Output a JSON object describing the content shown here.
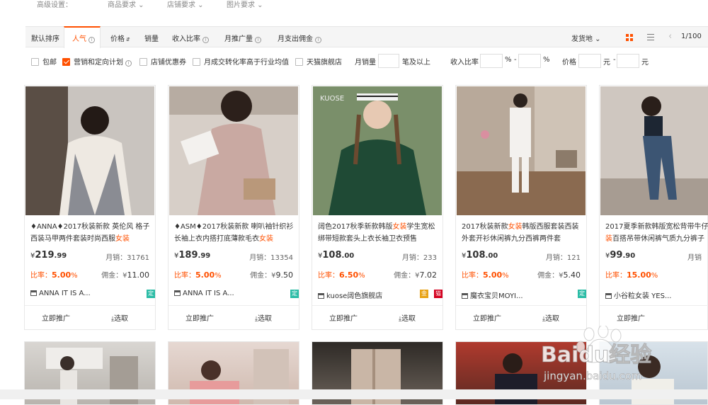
{
  "top_filters": {
    "label": "高级设置：",
    "items": [
      "商品要求",
      "店铺要求",
      "图片要求"
    ]
  },
  "sort_bar": {
    "items": [
      "默认排序",
      "人气",
      "价格",
      "销量",
      "收入比率",
      "月推广量",
      "月支出佣金"
    ],
    "active": "人气",
    "location": "发货地",
    "page": "1/100"
  },
  "filter_bar": {
    "options": [
      {
        "label": "包邮",
        "checked": false
      },
      {
        "label": "营销和定向计划",
        "checked": true
      },
      {
        "label": "店铺优惠券",
        "checked": false
      },
      {
        "label": "月成交转化率高于行业均值",
        "checked": false
      },
      {
        "label": "天猫旗舰店",
        "checked": false
      }
    ],
    "monthly_sales_label": "月销量",
    "monthly_sales_suffix": "笔及以上",
    "income_ratio_label": "收入比率",
    "percent": "%",
    "dash": "-",
    "price_label": "价格",
    "yuan": "元"
  },
  "products": [
    {
      "title_pre": "♦ANNA♦2017秋装新款 英伦风 格子西装马甲两件套装时尚西服",
      "title_hl": "女装",
      "title_post": "",
      "price_int": "219",
      "price_dec": ".99",
      "sales": "月销：31761",
      "rate": "5.00",
      "commission": "11.00",
      "shop": "ANNA IT IS A...",
      "badges": [
        "定"
      ]
    },
    {
      "title_pre": "♦ASM♦2017秋装新款 喇叭袖针织衫长袖上衣内搭打底薄款毛衣",
      "title_hl": "女装",
      "title_post": "",
      "price_int": "189",
      "price_dec": ".99",
      "sales": "月销：13354",
      "rate": "5.00",
      "commission": "9.50",
      "shop": "ANNA IT IS A...",
      "badges": [
        "定"
      ]
    },
    {
      "title_pre": "阔色2017秋季新款韩版",
      "title_hl": "女装",
      "title_post": "学生宽松绑带短款套头上衣长袖卫衣预售",
      "price_int": "108",
      "price_dec": ".00",
      "sales": "月销：233",
      "rate": "6.50",
      "commission": "7.02",
      "shop": "kuose阔色旗舰店",
      "badges": [
        "金",
        "猫"
      ]
    },
    {
      "title_pre": "2017秋装新款",
      "title_hl": "女装",
      "title_post": "韩版西服套装西装外套开衫休闲裤九分西裤两件套",
      "price_int": "108",
      "price_dec": ".00",
      "sales": "月销：121",
      "rate": "5.00",
      "commission": "5.40",
      "shop": "魔衣宝贝MOYI...",
      "badges": [
        "定"
      ]
    },
    {
      "title_pre": "2017夏季新款韩版宽松背带牛仔",
      "title_hl": "裤女装",
      "title_post": "百搭吊带休闲裤气质九分裤子",
      "price_int": "99",
      "price_dec": ".90",
      "sales": "月销",
      "rate": "15.00",
      "commission": "",
      "shop": "小谷粒女装 YES...",
      "badges": []
    }
  ],
  "card_labels": {
    "price_symbol": "¥",
    "rate_label": "比率：",
    "rate_suffix": "%",
    "commission_label": "佣金：",
    "commission_symbol": "¥",
    "promote": "立即推广",
    "choose": "选取"
  },
  "image_texts": {
    "kuose_logo": "KUOSE"
  },
  "watermark": {
    "brand": "Baidu经验",
    "url": "jingyan.baidu.com"
  },
  "colors": {
    "accent": "#ff5000",
    "badge_teal": "#2bbca6",
    "badge_gold": "#e8a317",
    "badge_red": "#d4001f"
  }
}
